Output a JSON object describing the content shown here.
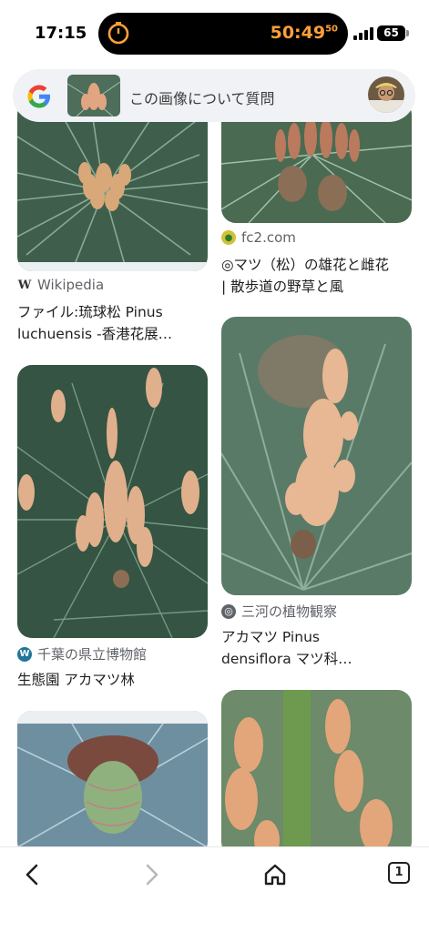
{
  "status": {
    "time": "17:15",
    "timer": "50:49",
    "timer_sub": "50",
    "battery": "65",
    "accent": "#ff9f3a"
  },
  "search": {
    "prompt": "この画像について質問",
    "logo_icon": "google-logo",
    "avatar_icon": "account-avatar"
  },
  "results": [
    {
      "source": "Wikipedia",
      "source_icon": "wikipedia-icon",
      "title_line1": "ファイル:琉球松 Pinus",
      "title_line2": "luchuensis -香港花展…"
    },
    {
      "source": "fc2.com",
      "source_icon": "fc2-icon",
      "title_line1": "◎マツ（松）の雄花と雌花",
      "title_line2": "| 散歩道の野草と風"
    },
    {
      "source": "千葉の県立博物館",
      "source_icon": "wordpress-icon",
      "title_line1": "生態園 アカマツ林",
      "title_line2": ""
    },
    {
      "source": "三河の植物観察",
      "source_icon": "globe-icon",
      "title_line1": "アカマツ Pinus",
      "title_line2": "densiflora マツ科…"
    }
  ],
  "toolbar": {
    "back_icon": "chevron-left-icon",
    "forward_icon": "chevron-right-icon",
    "home_icon": "home-icon",
    "tabs_count": "1"
  }
}
